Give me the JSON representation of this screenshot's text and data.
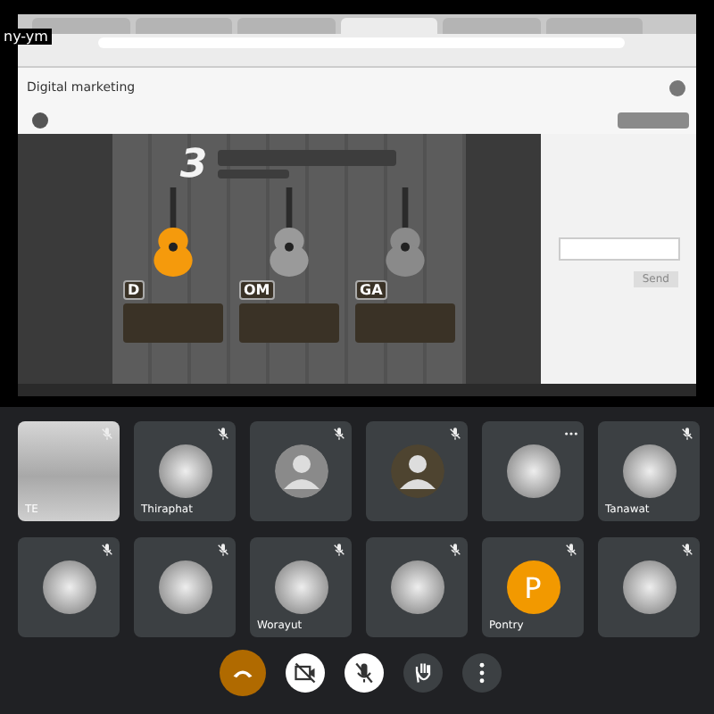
{
  "presenter_label": "ny-ym",
  "browser": {
    "tabs": [
      {
        "selected": false
      },
      {
        "selected": false
      },
      {
        "selected": false
      },
      {
        "selected": true
      },
      {
        "selected": false
      },
      {
        "selected": false
      }
    ],
    "document_title": "Digital marketing",
    "slide": {
      "number": "3",
      "sections": [
        {
          "label": "D",
          "color": "#f59a0c"
        },
        {
          "label": "OM",
          "color": "#9a9a9a"
        },
        {
          "label": "GA",
          "color": "#8a8a8a"
        }
      ]
    },
    "side_panel": {
      "send_button": "Send"
    }
  },
  "participants": [
    {
      "name": "TE",
      "kind": "photo",
      "muted": true
    },
    {
      "name": "Thiraphat",
      "kind": "avatar",
      "muted": true
    },
    {
      "kind": "default",
      "color": "#8a8a8a",
      "muted": true
    },
    {
      "kind": "default",
      "color": "#4e4430",
      "muted": true
    },
    {
      "kind": "avatar",
      "muted": false
    },
    {
      "name": "Tanawat",
      "kind": "avatar",
      "muted": true
    },
    {
      "kind": "avatar",
      "muted": true
    },
    {
      "kind": "avatar",
      "muted": true
    },
    {
      "name": "Worayut",
      "kind": "avatar",
      "muted": true
    },
    {
      "kind": "avatar",
      "muted": true
    },
    {
      "name": "Pontry",
      "kind": "letter",
      "letter": "P",
      "color": "#f29900",
      "muted": true
    },
    {
      "kind": "avatar",
      "muted": true
    }
  ],
  "controls": [
    {
      "kind": "hangup"
    },
    {
      "kind": "camera",
      "on": false
    },
    {
      "kind": "mic",
      "on": false
    },
    {
      "kind": "hand"
    },
    {
      "kind": "more"
    }
  ]
}
